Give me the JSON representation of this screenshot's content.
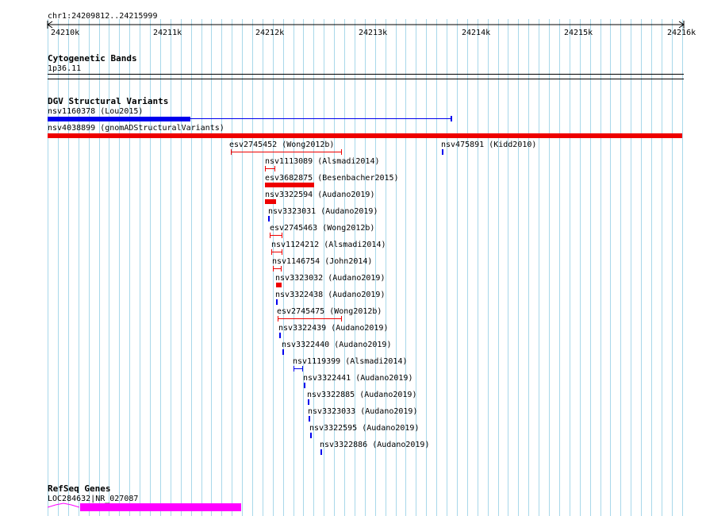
{
  "ruler": {
    "range_label": "chr1:24209812..24215999",
    "ticks": [
      "24210k",
      "24211k",
      "24212k",
      "24213k",
      "24214k",
      "24215k",
      "24216k"
    ]
  },
  "tracks": {
    "cytoband": {
      "title": "Cytogenetic Bands",
      "band": "1p36.11"
    },
    "dgv": {
      "title": "DGV Structural Variants",
      "features": [
        "nsv1160378 (Lou2015)",
        "nsv4038899 (gnomADStructuralVariants)",
        "esv2745452 (Wong2012b)",
        "nsv475891 (Kidd2010)",
        "nsv1113089 (Alsmadi2014)",
        "esv3682875 (Besenbacher2015)",
        "nsv3322594 (Audano2019)",
        "nsv3323031 (Audano2019)",
        "esv2745463 (Wong2012b)",
        "nsv1124212 (Alsmadi2014)",
        "nsv1146754 (John2014)",
        "nsv3323032 (Audano2019)",
        "nsv3322438 (Audano2019)",
        "esv2745475 (Wong2012b)",
        "nsv3322439 (Audano2019)",
        "nsv3322440 (Audano2019)",
        "nsv1119399 (Alsmadi2014)",
        "nsv3322441 (Audano2019)",
        "nsv3322885 (Audano2019)",
        "nsv3323033 (Audano2019)",
        "nsv3322595 (Audano2019)",
        "nsv3322886 (Audano2019)"
      ]
    },
    "refseq": {
      "title": "RefSeq Genes",
      "gene": "LOC284632|NR_027087"
    }
  },
  "colors": {
    "red": "#ee0000",
    "blue": "#0000ee",
    "magenta": "#ff00ff",
    "grid": "#a8d8ea"
  }
}
